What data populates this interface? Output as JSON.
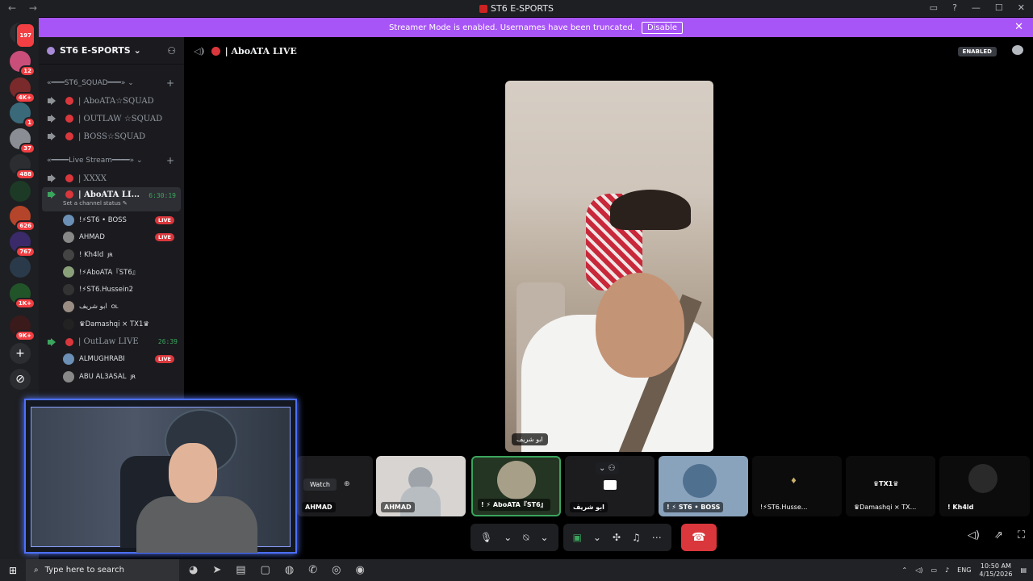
{
  "titlebar": {
    "title": "ST6 E-SPORTS",
    "nav": "← →"
  },
  "banner": {
    "text": "Streamer Mode is enabled. Usernames have been truncated.",
    "button": "Disable"
  },
  "guild_badges": [
    "197",
    "12",
    "4K+",
    "1",
    "37",
    "488",
    "626",
    "767",
    "1K+",
    "9K+"
  ],
  "server": {
    "name": "ST6 E-SPORTS"
  },
  "categories": [
    {
      "label": "«━━━ST6_SQUAD━━━»"
    },
    {
      "label": "«━━━━Live Stream━━━━»"
    }
  ],
  "squad_channels": [
    "| AboATA☆SQUAD",
    "| OUTLAW ☆SQUAD",
    "| BOSS☆SQUAD"
  ],
  "stream_channels": {
    "xxxx": "| XXXX",
    "active": {
      "name": "| AboATA LI...",
      "timer": "6:30:19",
      "status": "Set a channel status ✎"
    },
    "outlaw": {
      "name": "| OutLaw LIVE",
      "timer": "26:39"
    }
  },
  "users_aboata": [
    {
      "name": "!⚡ST6 • BOSS",
      "tag": "",
      "live": "LIVE"
    },
    {
      "name": "AHMAD",
      "tag": "",
      "live": "LIVE"
    },
    {
      "name": "! Kh4ld",
      "tag": "JR",
      "live": ""
    },
    {
      "name": "!⚡AboATA『ST6』",
      "tag": "",
      "live": ""
    },
    {
      "name": "!⚡ST6.Hussein2",
      "tag": "",
      "live": ""
    },
    {
      "name": "ابو شريف",
      "tag": "OL",
      "live": ""
    },
    {
      "name": "♛Damashqi × TX1♛",
      "tag": "",
      "live": ""
    }
  ],
  "users_outlaw": [
    {
      "name": "ALMUGHRABI",
      "tag": "",
      "live": "LIVE"
    },
    {
      "name": "ABU AL3ASAL",
      "tag": "JR",
      "live": ""
    }
  ],
  "header": {
    "channel": "| AboATA LIVE",
    "badge": "ENABLED"
  },
  "main_video": {
    "label": "ابو شريف"
  },
  "tiles": [
    {
      "name": "AHMAD",
      "watch": "Watch"
    },
    {
      "name": "AHMAD"
    },
    {
      "name": "! ⚡ AboATA『ST6』"
    },
    {
      "name": "ابو شريف"
    },
    {
      "name": "! ⚡ ST6 • BOSS"
    },
    {
      "name": "!⚡ST6.Husse..."
    },
    {
      "name": "♛Damashqi × TX..."
    },
    {
      "name": "! Kh4ld"
    }
  ],
  "tile_texts": {
    "tx1": "♛TX1♛"
  },
  "taskbar": {
    "search": "Type here to search",
    "lang": "ENG",
    "time": "10:50 AM",
    "date": "4/15/2026"
  }
}
